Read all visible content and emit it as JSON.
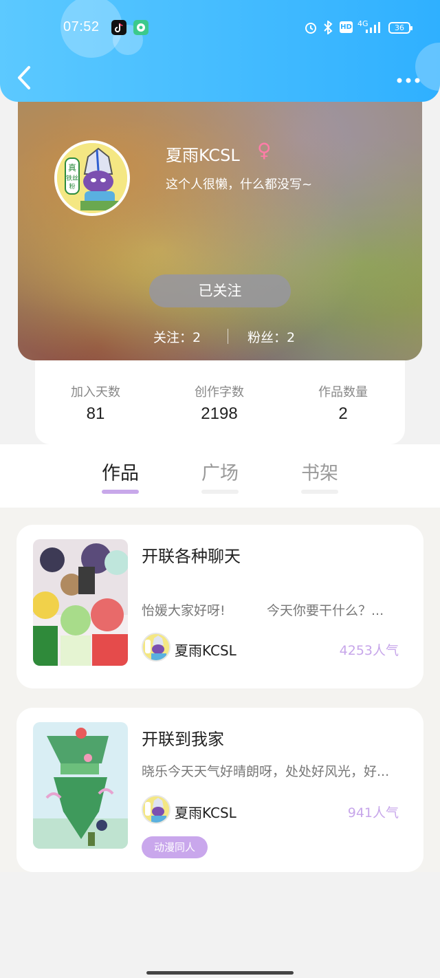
{
  "status_bar": {
    "time": "07:52",
    "network": "4G",
    "hd": "HD",
    "battery": "36",
    "icons": [
      "tiktok-icon",
      "message-app-icon",
      "alarm-icon",
      "bluetooth-icon",
      "hd-icon",
      "signal-icon",
      "battery-icon"
    ]
  },
  "header": {
    "back_icon": "chevron-left-icon",
    "more_icon": "more-dots-icon"
  },
  "profile": {
    "username": "夏雨KCSL",
    "gender_symbol": "♀",
    "bio": "这个人很懒，什么都没写~",
    "follow_button": "已关注",
    "following": "关注：2",
    "fans": "粉丝：2"
  },
  "stats": [
    {
      "label": "加入天数",
      "value": "81"
    },
    {
      "label": "创作字数",
      "value": "2198"
    },
    {
      "label": "作品数量",
      "value": "2"
    }
  ],
  "tabs": [
    {
      "label": "作品",
      "active": true
    },
    {
      "label": "广场",
      "active": false
    },
    {
      "label": "书架",
      "active": false
    }
  ],
  "works": [
    {
      "title": "开联各种聊天",
      "desc": "怡媛大家好呀!          今天你要干什么？...",
      "author": "夏雨KCSL",
      "popularity": "4253人气"
    },
    {
      "title": "开联到我家",
      "desc": "晓乐今天天气好晴朗呀，处处好风光，好...",
      "author": "夏雨KCSL",
      "popularity": "941人气",
      "tag": "动漫同人"
    }
  ],
  "colors": {
    "header_gradient_start": "#5cc9ff",
    "header_gradient_end": "#2fb0ff",
    "accent_purple": "#c8a8ea",
    "gender_pink": "#ff7ca8"
  }
}
